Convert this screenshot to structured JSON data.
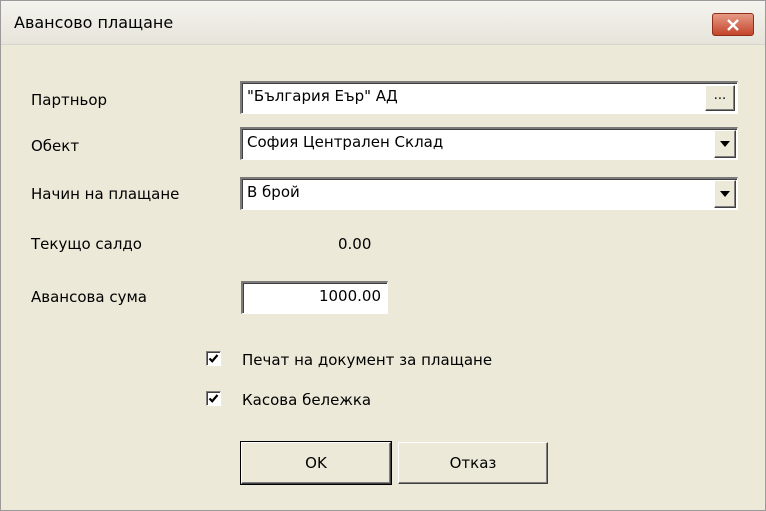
{
  "window": {
    "title": "Авансово плащане"
  },
  "form": {
    "partner": {
      "label": "Партньор",
      "value": "\"България Еър\" АД",
      "browse_label": "..."
    },
    "object": {
      "label": "Обект",
      "value": "София Централен Склад"
    },
    "payment_method": {
      "label": "Начин на плащане",
      "value": "В брой"
    },
    "current_balance": {
      "label": "Текущо салдо",
      "value": "0.00"
    },
    "advance_amount": {
      "label": "Авансова сума",
      "value": "1000.00"
    },
    "print_document": {
      "label": "Печат на документ за плащане",
      "checked": true
    },
    "cash_receipt": {
      "label": "Касова бележка",
      "checked": true
    }
  },
  "buttons": {
    "ok": "OK",
    "cancel": "Отказ"
  },
  "icons": {
    "close": "close-icon",
    "dropdown": "chevron-down-icon",
    "check": "check-icon"
  }
}
